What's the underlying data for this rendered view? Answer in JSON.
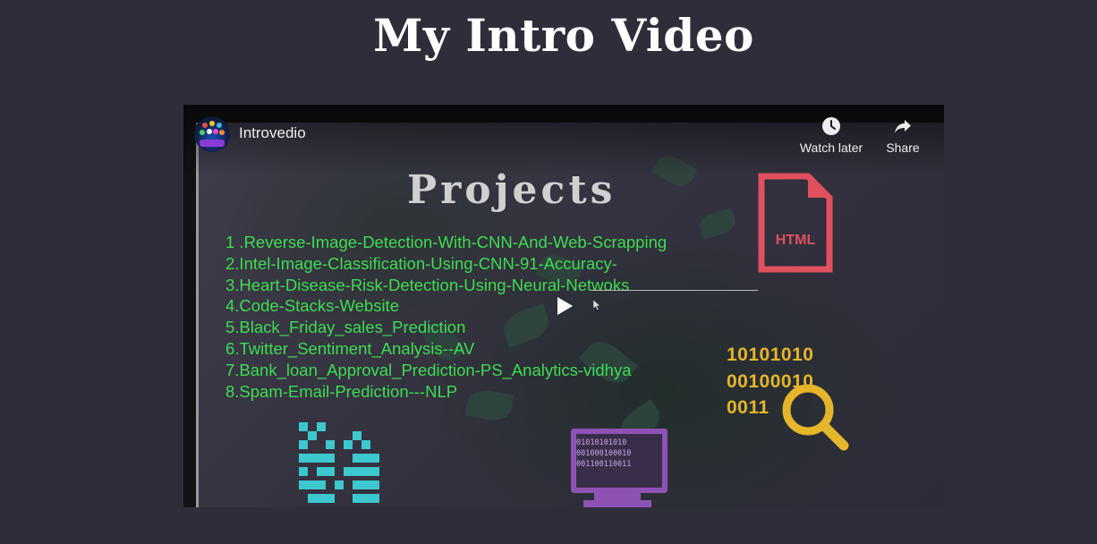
{
  "page": {
    "title": "My Intro Video"
  },
  "player": {
    "video_title": "Introvedio",
    "actions": {
      "watch_later": "Watch later",
      "share": "Share"
    },
    "play_icon": "play-icon",
    "colors": {
      "background": "#302d3b",
      "project_text": "#3ddc52",
      "html_icon": "#e0505f",
      "binary": "#e5b52a",
      "monitor": "#8e52b5",
      "pixel_grid": "#3dc7cf"
    }
  },
  "slide": {
    "heading": "Projects",
    "projects": [
      "1 .Reverse-Image-Detection-With-CNN-And-Web-Scrapping",
      "2.Intel-Image-Classification-Using-CNN-91-Accuracy-",
      "3.Heart-Disease-Risk-Detection-Using-Neural-Netwoks",
      " 4.Code-Stacks-Website",
      "5.Black_Friday_sales_Prediction",
      "6.Twitter_Sentiment_Analysis--AV",
      "7.Bank_loan_Approval_Prediction-PS_Analytics-vidhya",
      "8.Spam-Email-Prediction---NLP"
    ],
    "html_icon_label": "HTML",
    "binary_lines": [
      "10101010",
      "00100010",
      "0011"
    ],
    "monitor_code": "01010101010\n001000100010\n001100110011"
  }
}
